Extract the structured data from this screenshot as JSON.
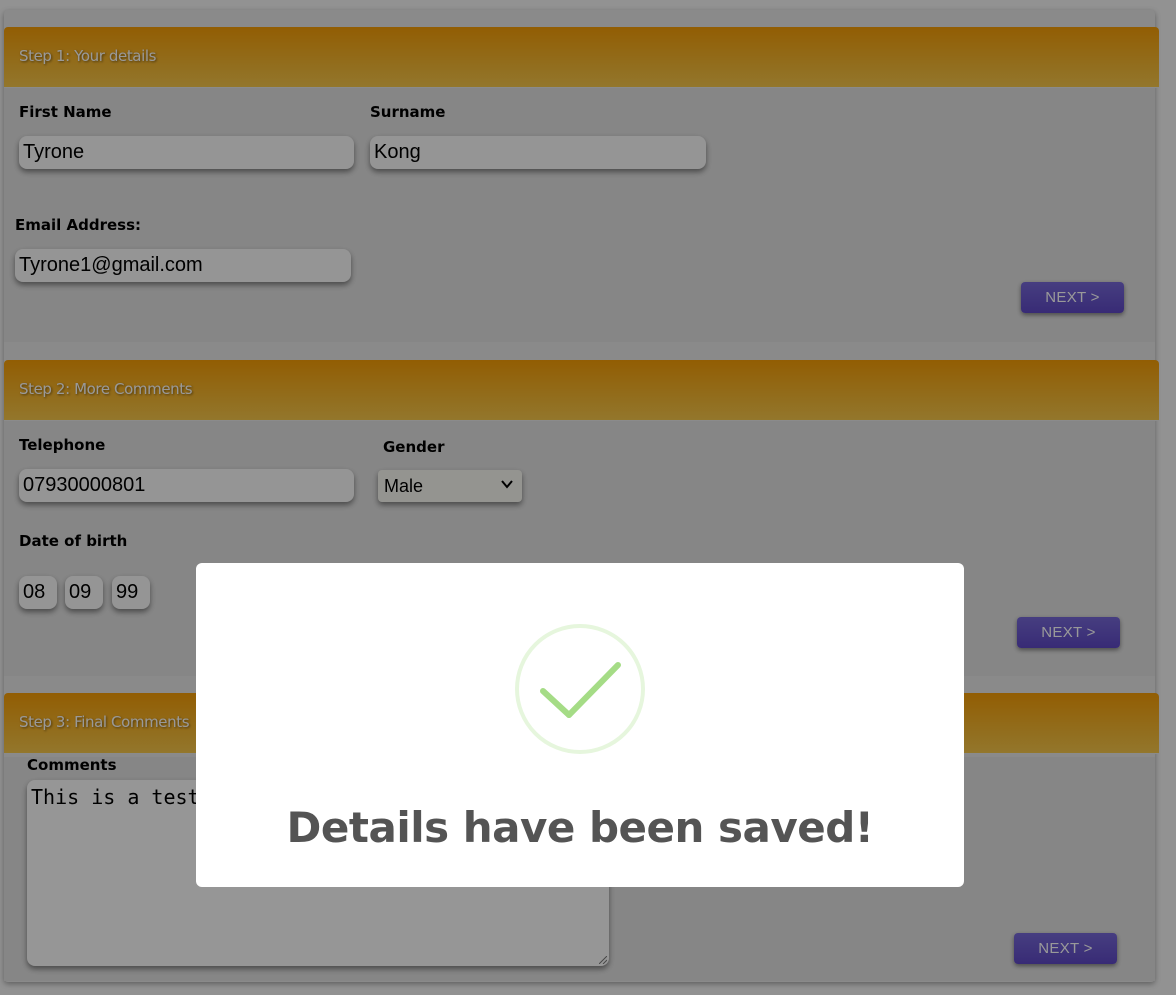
{
  "step1": {
    "title": "Step 1: Your details",
    "first_name_label": "First Name",
    "first_name_value": "Tyrone",
    "surname_label": "Surname",
    "surname_value": "Kong",
    "email_label": "Email Address:",
    "email_value": "Tyrone1@gmail.com",
    "next_label": "NEXT >"
  },
  "step2": {
    "title": "Step 2: More Comments",
    "telephone_label": "Telephone",
    "telephone_value": "07930000801",
    "gender_label": "Gender",
    "gender_value": "Male",
    "dob_label": "Date of birth",
    "dob_day": "08",
    "dob_month": "09",
    "dob_year": "99",
    "next_label": "NEXT >"
  },
  "step3": {
    "title": "Step 3: Final Comments",
    "comments_label": "Comments",
    "comments_value": "This is a test",
    "next_label": "NEXT >"
  },
  "modal": {
    "title": "Details have been saved!",
    "icon": "checkmark-icon"
  },
  "colors": {
    "header_gradient_top": "#f39c06",
    "header_gradient_bottom": "#f5c64a",
    "button": "#6a57cd",
    "check": "#a5dc86"
  }
}
